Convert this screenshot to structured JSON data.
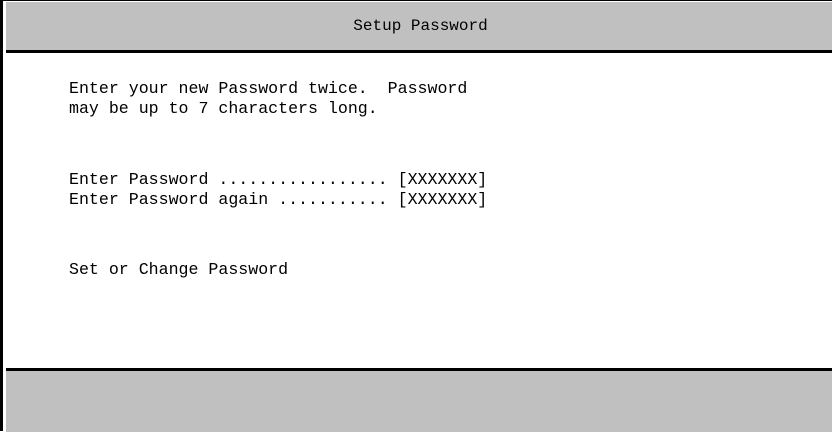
{
  "window": {
    "title": "Setup Password"
  },
  "instructions": {
    "line1": "Enter your new Password twice.  Password",
    "line2": "may be up to 7 characters long."
  },
  "fields": [
    {
      "label": "Enter Password ................. ",
      "value": "[XXXXXXX]"
    },
    {
      "label": "Enter Password again ........... ",
      "value": "[XXXXXXX]"
    }
  ],
  "action": {
    "label": "Set or Change Password"
  },
  "colors": {
    "bar_background": "#c0c0c0",
    "content_background": "#ffffff",
    "text": "#000000"
  }
}
